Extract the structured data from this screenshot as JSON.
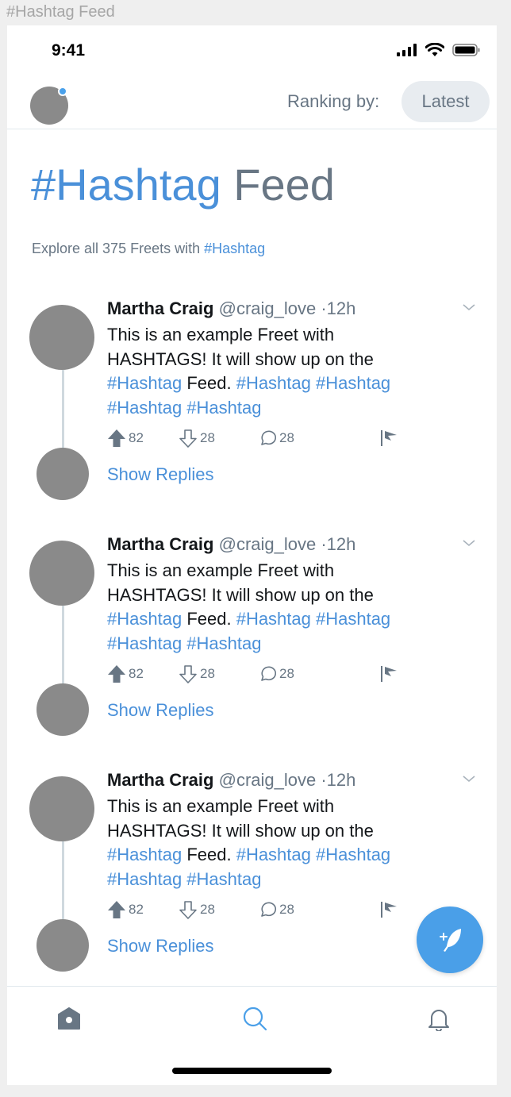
{
  "frame_title": "#Hashtag Feed",
  "status_bar": {
    "time": "9:41"
  },
  "topbar": {
    "ranking_label": "Ranking by:",
    "ranking_value": "Latest"
  },
  "heading": {
    "hash": "#Hashtag",
    "word": "Feed"
  },
  "explore": {
    "prefix": "Explore all 375 Freets with",
    "tag": "#Hashtag"
  },
  "freets": [
    {
      "name": "Martha Craig",
      "handle": "@craig_love",
      "time": "·12h",
      "text_lines": [
        "This is an example Freet with",
        "HASHTAGS! It will show up on the"
      ],
      "tag_feed": "#Hashtag",
      "feed_word": "Feed.",
      "tags_line3": "#Hashtag #Hashtag",
      "tags_line4": "#Hashtag #Hashtag",
      "upvotes": "82",
      "downvotes": "28",
      "replies": "28",
      "show_replies": "Show Replies"
    },
    {
      "name": "Martha Craig",
      "handle": "@craig_love",
      "time": "·12h",
      "text_lines": [
        "This is an example Freet with",
        "HASHTAGS! It will show up on the"
      ],
      "tag_feed": "#Hashtag",
      "feed_word": "Feed.",
      "tags_line3": "#Hashtag #Hashtag",
      "tags_line4": "#Hashtag #Hashtag",
      "upvotes": "82",
      "downvotes": "28",
      "replies": "28",
      "show_replies": "Show Replies"
    },
    {
      "name": "Martha Craig",
      "handle": "@craig_love",
      "time": "·12h",
      "text_lines": [
        "This is an example Freet with",
        "HASHTAGS! It will show up on the"
      ],
      "tag_feed": "#Hashtag",
      "feed_word": "Feed.",
      "tags_line3": "#Hashtag #Hashtag",
      "tags_line4": "#Hashtag #Hashtag",
      "upvotes": "82",
      "downvotes": "28",
      "replies": "28",
      "show_replies": "Show Replies"
    }
  ],
  "icons": {
    "status": [
      "signal-icon",
      "wifi-icon",
      "battery-icon"
    ],
    "freet_actions": [
      "upvote-icon",
      "downvote-icon",
      "reply-icon",
      "flag-icon"
    ],
    "fab": "compose-feather-icon",
    "tabs": [
      "home-icon",
      "search-icon",
      "bell-icon"
    ]
  },
  "colors": {
    "accent": "#4a90d9",
    "muted": "#687684",
    "avatar": "#8a8a8a",
    "fab": "#4a9fe8"
  }
}
